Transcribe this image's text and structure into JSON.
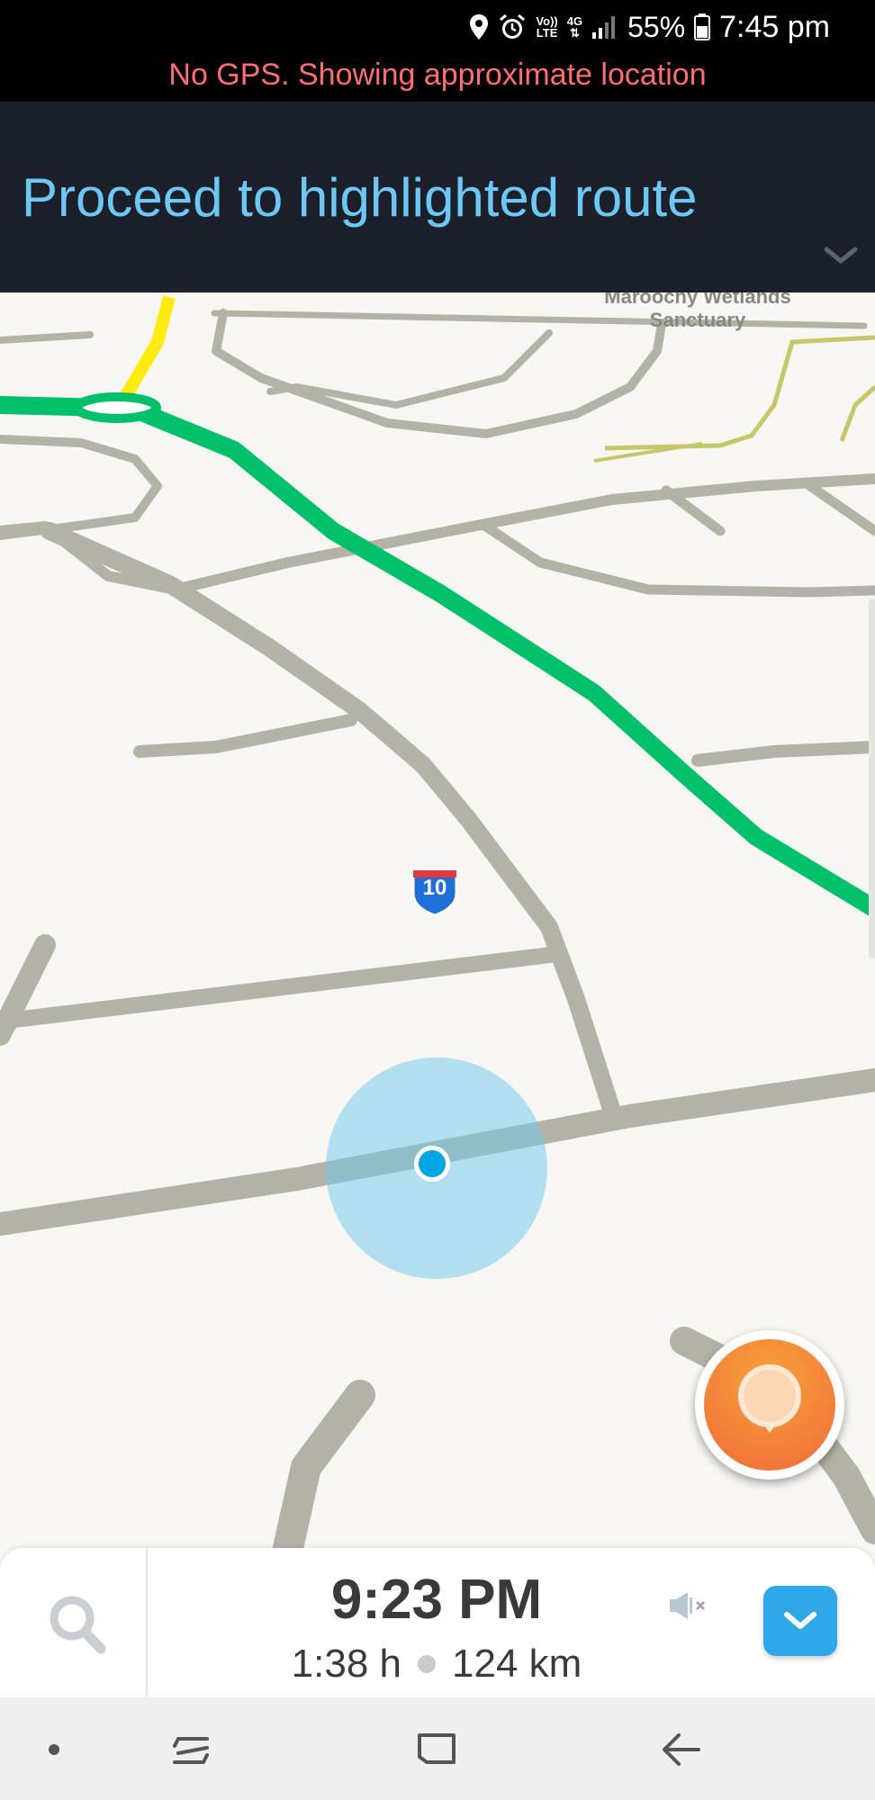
{
  "status_bar": {
    "network_top": "Vo))",
    "network_bottom": "LTE",
    "data_type": "4G",
    "battery": "55%",
    "time": "7:45 pm"
  },
  "gps_warning": "No GPS. Showing approximate location",
  "instruction_banner": {
    "text": "Proceed to highlighted route"
  },
  "map": {
    "place_label_line1": "Maroochy Wetlands",
    "place_label_line2": "Sanctuary",
    "route_shield": "10",
    "colors": {
      "route": "#00c06a",
      "roads": "#b4b2a6",
      "highway": "#ffeb10",
      "location_dot": "#00a6e4"
    }
  },
  "report_button": {
    "icon": "report-pin-icon"
  },
  "bottom_panel": {
    "eta_time": "9:23 PM",
    "duration": "1:38 h",
    "distance": "124 km"
  },
  "nav_bar": {
    "items": [
      "dot-icon",
      "recents-icon",
      "home-icon",
      "back-icon"
    ]
  }
}
